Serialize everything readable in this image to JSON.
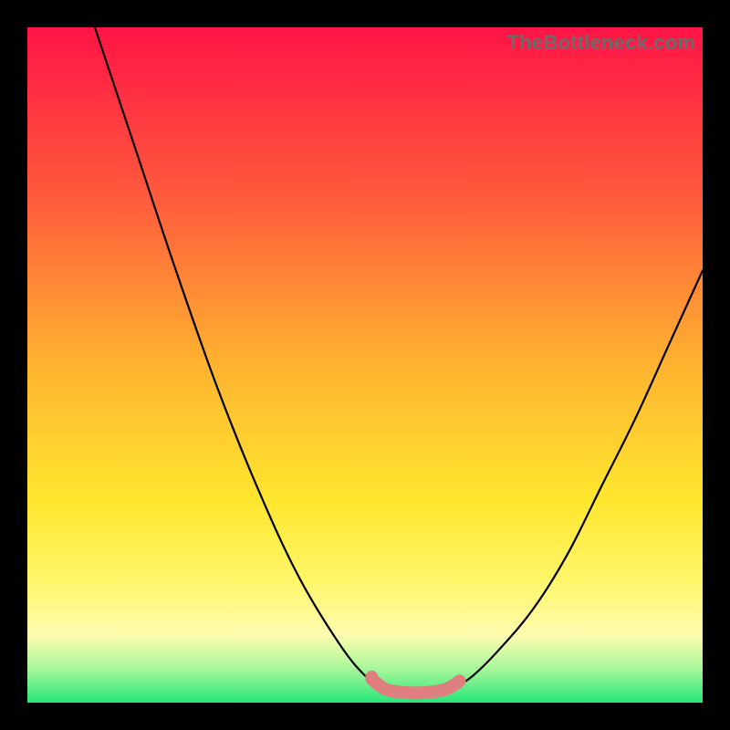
{
  "watermark": "TheBottleneck.com",
  "chart_data": {
    "type": "line",
    "title": "",
    "xlabel": "",
    "ylabel": "",
    "xlim": [
      0,
      100
    ],
    "ylim": [
      0,
      100
    ],
    "grid": false,
    "legend": false,
    "series": [
      {
        "name": "left-curve",
        "color": "#000000",
        "x": [
          10,
          16,
          22,
          28,
          34,
          40,
          46,
          50,
          53
        ],
        "y": [
          100,
          82,
          64,
          47,
          32,
          19,
          9,
          4,
          2
        ]
      },
      {
        "name": "right-curve",
        "color": "#000000",
        "x": [
          63,
          66,
          70,
          75,
          80,
          85,
          90,
          95,
          100
        ],
        "y": [
          2,
          4,
          8,
          14,
          22,
          32,
          42,
          53,
          64
        ]
      },
      {
        "name": "valley-marker",
        "color": "#e07f7f",
        "x": [
          51,
          53,
          56,
          59,
          62,
          64
        ],
        "y": [
          3.5,
          2,
          1.5,
          1.5,
          2,
          3.2
        ]
      },
      {
        "name": "valley-dot",
        "color": "#e07f7f",
        "type": "scatter",
        "x": [
          51
        ],
        "y": [
          3.8
        ]
      }
    ],
    "background_gradient": {
      "stops": [
        {
          "offset": 0.0,
          "color": "#ff1445"
        },
        {
          "offset": 0.25,
          "color": "#ff5a3c"
        },
        {
          "offset": 0.5,
          "color": "#ffb330"
        },
        {
          "offset": 0.7,
          "color": "#ffe62e"
        },
        {
          "offset": 0.82,
          "color": "#fff66a"
        },
        {
          "offset": 0.9,
          "color": "#fffcb0"
        },
        {
          "offset": 0.95,
          "color": "#a7f79a"
        },
        {
          "offset": 1.0,
          "color": "#27e67a"
        }
      ]
    }
  }
}
